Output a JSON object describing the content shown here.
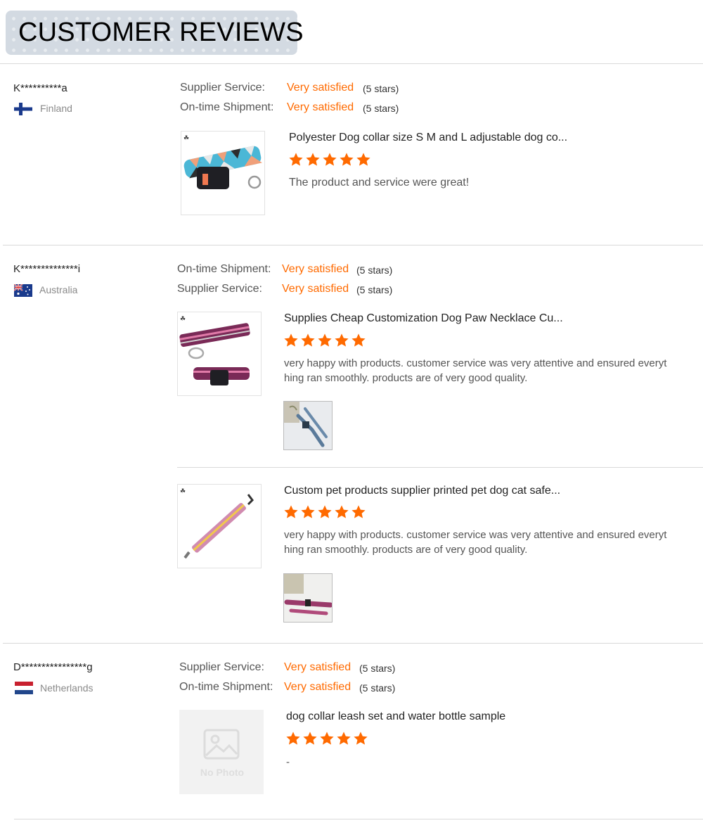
{
  "header": {
    "title": "CUSTOMER REVIEWS"
  },
  "rating_scale": 5,
  "reviews": [
    {
      "buyer": "K**********a",
      "country": "Finland",
      "ratings": [
        {
          "label": "Supplier Service:",
          "value": "Very satisfied",
          "stars_text": "(5 stars)"
        },
        {
          "label": "On-time Shipment:",
          "value": "Very satisfied",
          "stars_text": "(5 stars)"
        }
      ],
      "items": [
        {
          "title": "Polyester Dog collar size S M and L adjustable dog co...",
          "stars": 5,
          "text": "The product and service were great!"
        }
      ]
    },
    {
      "buyer": "K**************i",
      "country": "Australia",
      "ratings": [
        {
          "label": "On-time Shipment:",
          "value": "Very satisfied",
          "stars_text": "(5 stars)"
        },
        {
          "label": "Supplier Service:",
          "value": "Very satisfied",
          "stars_text": "(5 stars)"
        }
      ],
      "items": [
        {
          "title": "Supplies Cheap Customization Dog Paw Necklace Cu...",
          "stars": 5,
          "text_line1": "very happy with products. customer service was very attentive and ensured everyt",
          "text_line2": "hing ran smoothly. products are of very good quality."
        },
        {
          "title": "Custom pet products supplier printed pet dog cat safe...",
          "stars": 5,
          "text_line1": "very happy with products. customer service was very attentive and ensured everyt",
          "text_line2": "hing ran smoothly. products are of very good quality."
        }
      ]
    },
    {
      "buyer": "D****************g",
      "country": "Netherlands",
      "ratings": [
        {
          "label": "Supplier Service:",
          "value": "Very satisfied",
          "stars_text": "(5 stars)"
        },
        {
          "label": "On-time Shipment:",
          "value": "Very satisfied",
          "stars_text": "(5 stars)"
        }
      ],
      "items": [
        {
          "title": "dog collar leash set and water bottle sample",
          "stars": 5,
          "text": "-",
          "no_photo_text": "No Photo"
        }
      ]
    }
  ],
  "colors": {
    "accent": "#ff6a00",
    "divider": "#d9d9d9",
    "header_bg": "#d3dae2"
  },
  "icons": [
    "flag-finland-icon",
    "flag-australia-icon",
    "flag-netherlands-icon",
    "star-icon",
    "placeholder-image-icon"
  ]
}
